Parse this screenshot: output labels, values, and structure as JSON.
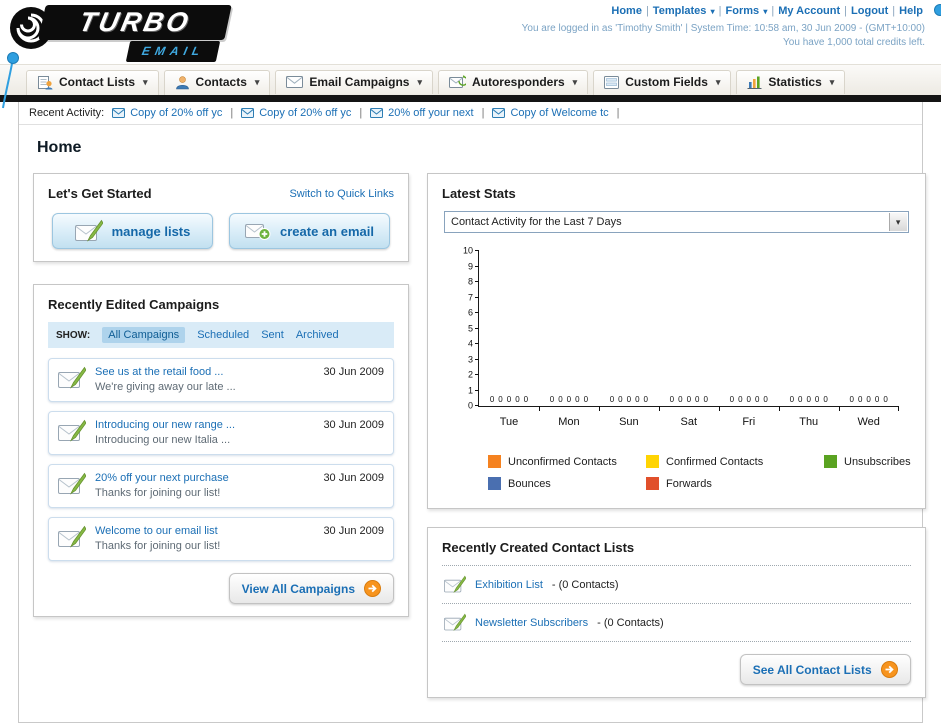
{
  "icons": {
    "chevron_down": "▾",
    "separator": "|"
  },
  "header": {
    "logo_main": "TURBO",
    "logo_sub": "EMAIL",
    "links": [
      {
        "label": "Home",
        "dropdown": false
      },
      {
        "label": "Templates",
        "dropdown": true
      },
      {
        "label": "Forms",
        "dropdown": true
      },
      {
        "label": "My Account",
        "dropdown": false
      },
      {
        "label": "Logout",
        "dropdown": false
      },
      {
        "label": "Help",
        "dropdown": false
      }
    ],
    "login_info": "You are logged in as 'Timothy Smith' | System Time: 10:58 am, 30 Jun 2009 - (GMT+10:00)",
    "credits": "You have 1,000 total credits left."
  },
  "main_nav": {
    "items": [
      {
        "label": "Contact Lists",
        "icon": "contact-lists"
      },
      {
        "label": "Contacts",
        "icon": "contacts"
      },
      {
        "label": "Email Campaigns",
        "icon": "email-campaigns"
      },
      {
        "label": "Autoresponders",
        "icon": "autoresponders"
      },
      {
        "label": "Custom Fields",
        "icon": "custom-fields"
      },
      {
        "label": "Statistics",
        "icon": "statistics"
      }
    ]
  },
  "recent_activity": {
    "label": "Recent Activity:",
    "items": [
      "Copy of 20% off yc",
      "Copy of 20% off yc",
      "20% off your next",
      "Copy of Welcome tc"
    ]
  },
  "page_title": "Home",
  "get_started": {
    "title": "Let's Get Started",
    "switch_link": "Switch to Quick Links",
    "buttons": [
      {
        "label": "manage lists",
        "icon": "envelope-pencil"
      },
      {
        "label": "create an email",
        "icon": "envelope-plus"
      }
    ]
  },
  "campaigns": {
    "title": "Recently Edited Campaigns",
    "show_label": "SHOW:",
    "filters": [
      {
        "label": "All Campaigns",
        "active": true
      },
      {
        "label": "Scheduled",
        "active": false
      },
      {
        "label": "Sent",
        "active": false
      },
      {
        "label": "Archived",
        "active": false
      }
    ],
    "items": [
      {
        "title": "See us at the retail food ...",
        "subtitle": "We're giving away our late ...",
        "date": "30 Jun 2009"
      },
      {
        "title": "Introducing our new range ...",
        "subtitle": "Introducing our new Italia ...",
        "date": "30 Jun 2009"
      },
      {
        "title": "20% off your next purchase",
        "subtitle": "Thanks for joining our list!",
        "date": "30 Jun 2009"
      },
      {
        "title": "Welcome to our email list",
        "subtitle": "Thanks for joining our list!",
        "date": "30 Jun 2009"
      }
    ],
    "view_all_label": "View All Campaigns"
  },
  "stats": {
    "title": "Latest Stats",
    "selected_option": "Contact Activity for the Last 7 Days"
  },
  "chart_data": {
    "type": "bar",
    "title": "Contact Activity for the Last 7 Days",
    "categories": [
      "Tue",
      "Mon",
      "Sun",
      "Sat",
      "Fri",
      "Thu",
      "Wed"
    ],
    "series": [
      {
        "name": "Unconfirmed Contacts",
        "color": "#f58220",
        "values": [
          0,
          0,
          0,
          0,
          0,
          0,
          0
        ]
      },
      {
        "name": "Confirmed Contacts",
        "color": "#ffd403",
        "values": [
          0,
          0,
          0,
          0,
          0,
          0,
          0
        ]
      },
      {
        "name": "Unsubscribes",
        "color": "#5aa321",
        "values": [
          0,
          0,
          0,
          0,
          0,
          0,
          0
        ]
      },
      {
        "name": "Bounces",
        "color": "#4a6fb0",
        "values": [
          0,
          0,
          0,
          0,
          0,
          0,
          0
        ]
      },
      {
        "name": "Forwards",
        "color": "#e1502b",
        "values": [
          0,
          0,
          0,
          0,
          0,
          0,
          0
        ]
      }
    ],
    "ylim": [
      0,
      10
    ],
    "ytick_step": 1,
    "show_value_labels": true,
    "legend_position": "bottom",
    "grid": false
  },
  "contact_lists": {
    "title": "Recently Created Contact Lists",
    "items": [
      {
        "name": "Exhibition List",
        "suffix": "- (0 Contacts)"
      },
      {
        "name": "Newsletter Subscribers",
        "suffix": "- (0 Contacts)"
      }
    ],
    "see_all_label": "See All Contact Lists"
  }
}
